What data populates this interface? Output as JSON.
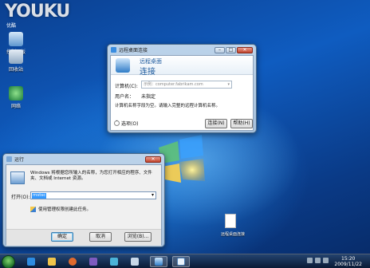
{
  "watermark": {
    "brand": "YOUKU",
    "sub": "优酷"
  },
  "desktop": {
    "icons": [
      {
        "label": "控制面板"
      },
      {
        "label": "回收站"
      },
      {
        "label": "网络"
      }
    ],
    "file_label": "远程桌面连接"
  },
  "rdp": {
    "title": "远程桌面连接",
    "header_line1": "远程桌面",
    "header_line2": "连接",
    "computer_label": "计算机(C):",
    "computer_value": "示例：computer.fabrikam.com",
    "user_label": "用户名：",
    "user_value": "未指定",
    "hint": "计算机名称字段为空。请输入完整的远程计算机名称。",
    "options_label": "选项(O)",
    "connect_label": "连接(N)",
    "help_label": "帮助(H)"
  },
  "run": {
    "title": "运行",
    "desc": "Windows 将根据您所输入的名称，为您打开相应的程序、文件夹、文档或 Internet 资源。",
    "open_label": "打开(O):",
    "open_value": "mstsc",
    "admin_note": "使用管理权限创建此任务。",
    "ok_label": "确定",
    "cancel_label": "取消",
    "browse_label": "浏览(B)..."
  },
  "taskbar": {
    "time": "15:20",
    "date": "2009/11/22"
  },
  "colors": {
    "accent": "#3c7fb1",
    "title_blue": "#1e5b9e"
  }
}
